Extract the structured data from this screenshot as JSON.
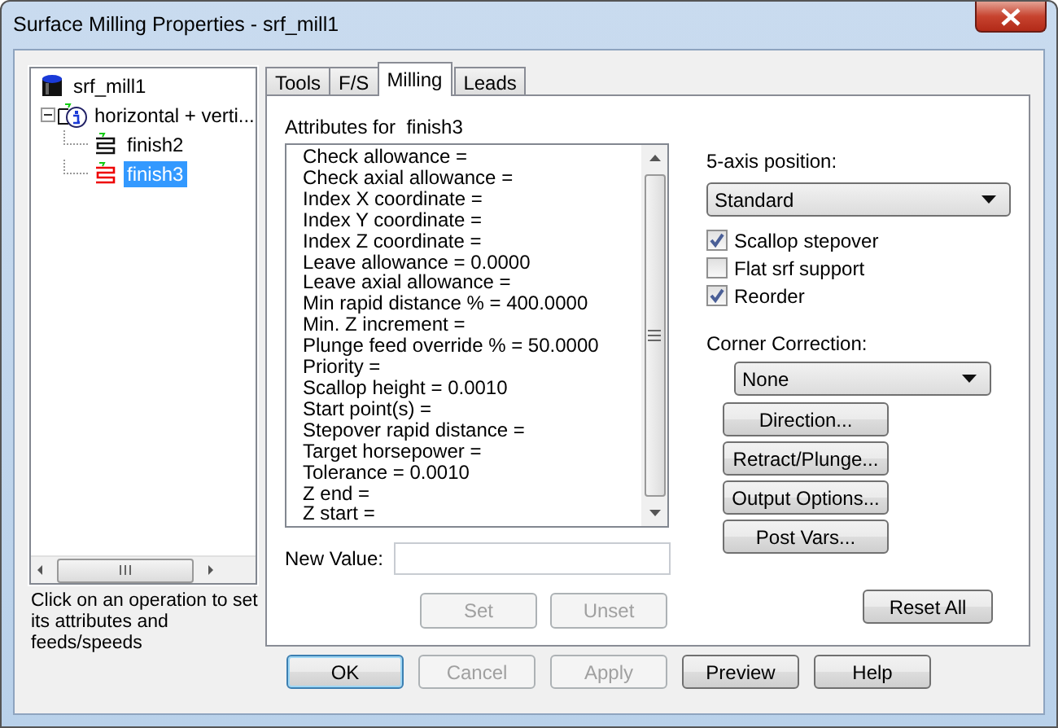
{
  "window": {
    "title": "Surface Milling Properties - srf_mill1"
  },
  "tree": [
    {
      "label": "srf_mill1",
      "kind": "mill",
      "selected": false,
      "children": [
        {
          "label": "horizontal + verti...",
          "kind": "group",
          "selected": false,
          "expanded": true,
          "children": [
            {
              "label": "finish2",
              "kind": "finish",
              "selected": false
            },
            {
              "label": "finish3",
              "kind": "finish",
              "selected": true
            }
          ]
        }
      ]
    }
  ],
  "tree_hint": "Click on an operation to set its attributes and feeds/speeds",
  "tabs": [
    {
      "label": "Tools",
      "selected": false
    },
    {
      "label": "F/S",
      "selected": false
    },
    {
      "label": "Milling",
      "selected": true
    },
    {
      "label": "Leads",
      "selected": false
    }
  ],
  "attributes": {
    "label": "Attributes for  finish3",
    "items": [
      "Check allowance =",
      "Check axial allowance =",
      "Index X coordinate =",
      "Index Y coordinate =",
      "Index Z coordinate =",
      "Leave allowance = 0.0000",
      "Leave axial allowance =",
      "Min rapid distance % = 400.0000",
      "Min. Z increment =",
      "Plunge feed override % = 50.0000",
      "Priority =",
      "Scallop height = 0.0010",
      "Start point(s) =",
      "Stepover rapid distance =",
      "Target horsepower =",
      "Tolerance = 0.0010",
      "Z end =",
      "Z start ="
    ]
  },
  "new_value": {
    "label": "New Value:"
  },
  "value_buttons": [
    {
      "label": "Set",
      "disabled": true
    },
    {
      "label": "Unset",
      "disabled": true
    }
  ],
  "five_axis": {
    "label": "5-axis position:",
    "value": "Standard"
  },
  "options": [
    {
      "label": "Scallop stepover",
      "checked": true
    },
    {
      "label": "Flat srf support",
      "checked": false
    },
    {
      "label": "Reorder",
      "checked": true
    }
  ],
  "corner": {
    "label": "Corner Correction:",
    "value": "None"
  },
  "side_buttons": [
    "Direction...",
    "Retract/Plunge...",
    "Output Options...",
    "Post Vars..."
  ],
  "reset_button": "Reset All",
  "footer_buttons": [
    {
      "label": "OK",
      "disabled": false,
      "default": true
    },
    {
      "label": "Cancel",
      "disabled": true,
      "default": false
    },
    {
      "label": "Apply",
      "disabled": true,
      "default": false
    },
    {
      "label": "Preview",
      "disabled": false,
      "default": false
    },
    {
      "label": "Help",
      "disabled": false,
      "default": false
    }
  ]
}
